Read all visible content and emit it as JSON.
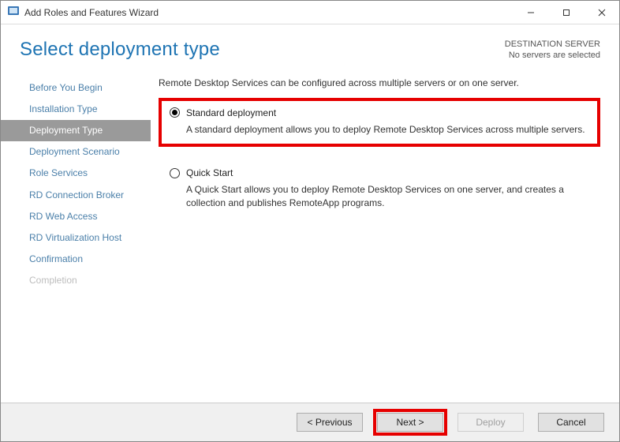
{
  "window": {
    "title": "Add Roles and Features Wizard"
  },
  "header": {
    "page_title": "Select deployment type",
    "dest_line1": "DESTINATION SERVER",
    "dest_line2": "No servers are selected"
  },
  "sidebar": {
    "items": [
      {
        "label": "Before You Begin",
        "state": "normal"
      },
      {
        "label": "Installation Type",
        "state": "normal"
      },
      {
        "label": "Deployment Type",
        "state": "active"
      },
      {
        "label": "Deployment Scenario",
        "state": "normal"
      },
      {
        "label": "Role Services",
        "state": "normal"
      },
      {
        "label": "RD Connection Broker",
        "state": "normal"
      },
      {
        "label": "RD Web Access",
        "state": "normal"
      },
      {
        "label": "RD Virtualization Host",
        "state": "normal"
      },
      {
        "label": "Confirmation",
        "state": "normal"
      },
      {
        "label": "Completion",
        "state": "disabled"
      }
    ]
  },
  "main": {
    "intro": "Remote Desktop Services can be configured across multiple servers or on one server.",
    "options": [
      {
        "label": "Standard deployment",
        "desc": "A standard deployment allows you to deploy Remote Desktop Services across multiple servers.",
        "selected": true,
        "highlighted": true
      },
      {
        "label": "Quick Start",
        "desc": "A Quick Start allows you to deploy Remote Desktop Services on one server, and creates a collection and publishes RemoteApp programs.",
        "selected": false,
        "highlighted": false
      }
    ]
  },
  "footer": {
    "previous": "< Previous",
    "next": "Next >",
    "deploy": "Deploy",
    "cancel": "Cancel",
    "next_highlighted": true,
    "deploy_enabled": false
  },
  "colors": {
    "accent": "#1e74b3",
    "highlight": "#e60000",
    "sidebar_active_bg": "#9a9a9a"
  }
}
